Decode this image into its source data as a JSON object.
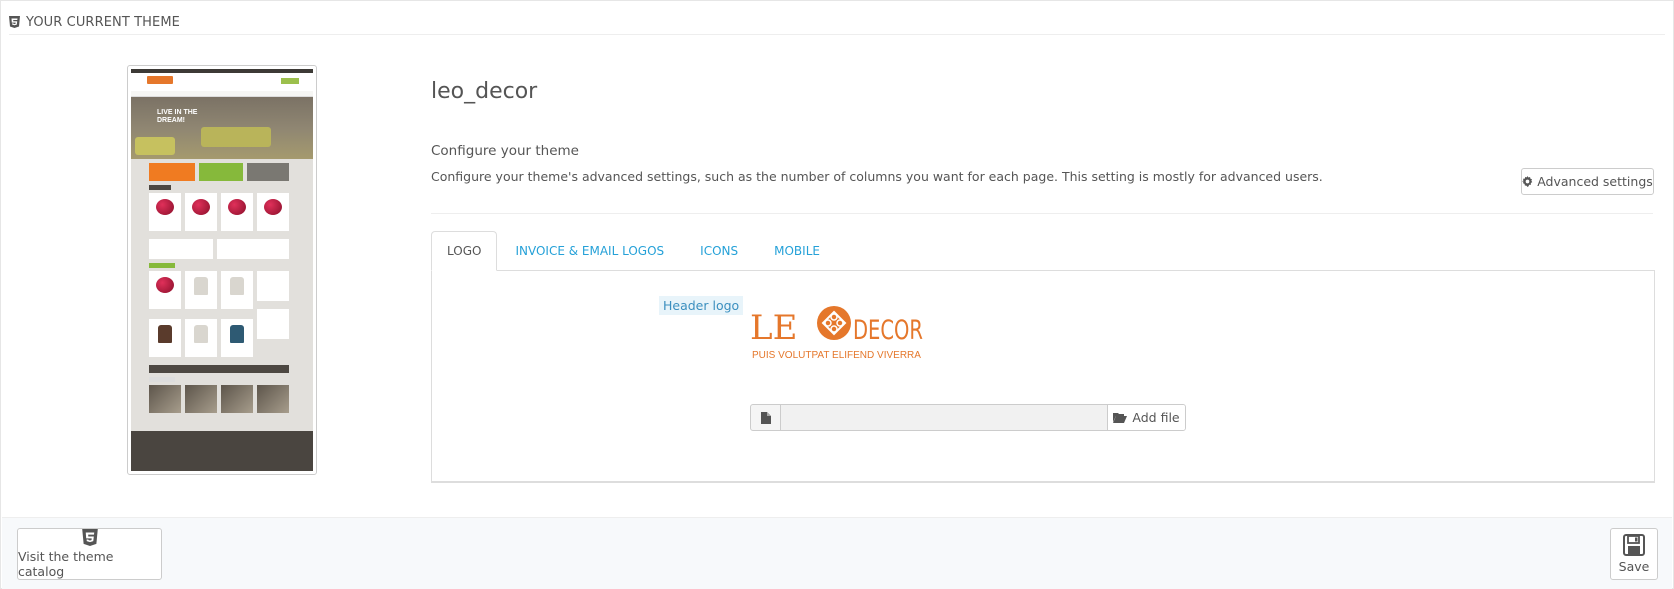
{
  "panel": {
    "heading_icon": "html5-icon",
    "heading": "YOUR CURRENT THEME"
  },
  "theme": {
    "name": "leo_decor",
    "configure_title": "Configure your theme",
    "configure_desc": "Configure your theme's advanced settings, such as the number of columns you want for each page. This setting is mostly for advanced users.",
    "advanced_button": "Advanced settings",
    "advanced_icon": "gear-icon",
    "preview_texts": [
      "LIVE IN THE",
      "DREAM!"
    ]
  },
  "tabs": [
    {
      "label": "LOGO",
      "active": true
    },
    {
      "label": "INVOICE & EMAIL LOGOS",
      "active": false
    },
    {
      "label": "ICONS",
      "active": false
    },
    {
      "label": "MOBILE",
      "active": false
    }
  ],
  "logo_tab": {
    "label": "Header logo",
    "logo_text_left": "LE",
    "logo_text_right": "DECOR",
    "logo_tagline": "PUIS VOLUTPAT ELIFEND VIVERRA",
    "file_value": "",
    "add_file_button": "Add file",
    "file_icon": "file-icon",
    "folder_icon": "folder-open-icon"
  },
  "footer": {
    "catalog_button": "Visit the theme catalog",
    "catalog_icon": "html5-icon",
    "save_button": "Save",
    "save_icon": "floppy-disk-icon"
  },
  "colors": {
    "link": "#25a1d8",
    "brand_orange": "#e5772b",
    "text": "#555555"
  }
}
